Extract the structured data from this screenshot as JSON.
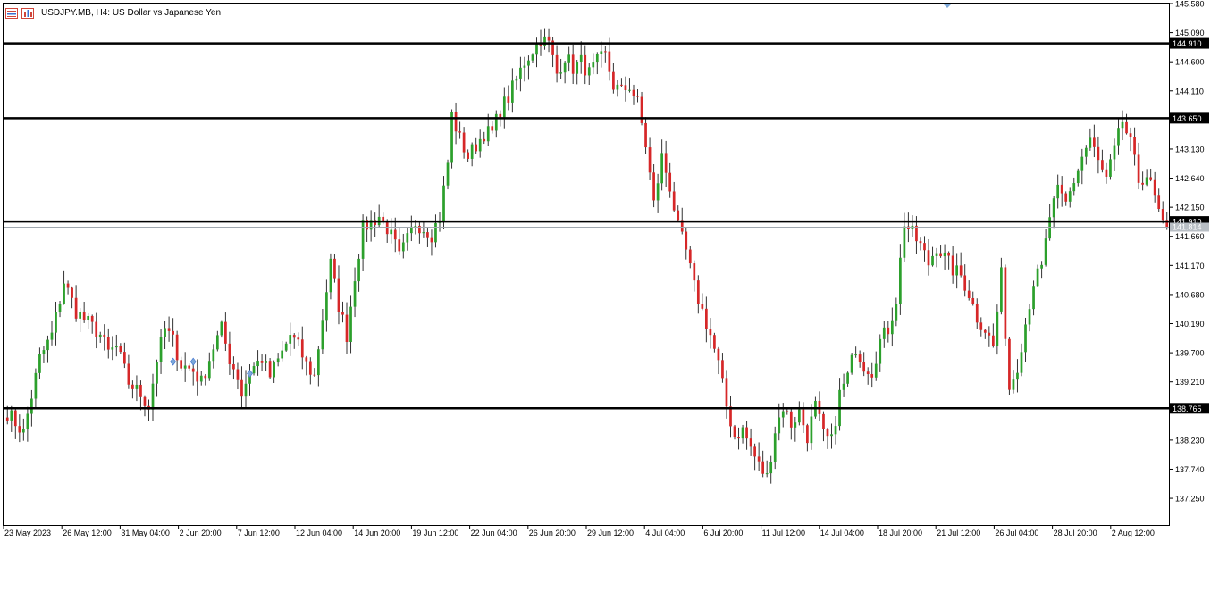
{
  "window": {
    "title": "USDJPY.MB, H4:  US Dollar vs Japanese Yen",
    "icons": [
      "chart-list-icon",
      "bar-chart-icon"
    ]
  },
  "colors": {
    "bull": "#2ca02c",
    "bear": "#d62728",
    "wick": "#333333",
    "level_line": "#000000",
    "price_line": "#a0a8b0",
    "axis": "#000000",
    "marker": "#7ba7d8"
  },
  "chart_data": {
    "type": "candlestick",
    "symbol": "USDJPY.MB",
    "timeframe": "H4",
    "ylim": [
      136.8,
      145.58
    ],
    "y_ticks": [
      "145.580",
      "145.090",
      "144.600",
      "144.110",
      "143.130",
      "142.640",
      "142.150",
      "141.660",
      "141.170",
      "140.680",
      "140.190",
      "139.700",
      "139.210",
      "138.230",
      "137.740",
      "137.250"
    ],
    "x_ticks": [
      "23 May 2023",
      "26 May 12:00",
      "31 May 04:00",
      "2 Jun 20:00",
      "7 Jun 12:00",
      "12 Jun 04:00",
      "14 Jun 20:00",
      "19 Jun 12:00",
      "22 Jun 04:00",
      "26 Jun 20:00",
      "29 Jun 12:00",
      "4 Jul 04:00",
      "6 Jul 20:00",
      "11 Jul 12:00",
      "14 Jul 04:00",
      "18 Jul 20:00",
      "21 Jul 12:00",
      "26 Jul 04:00",
      "28 Jul 20:00",
      "2 Aug 12:00"
    ],
    "levels": [
      {
        "label": "144.910",
        "value": 144.91
      },
      {
        "label": "143.650",
        "value": 143.65
      },
      {
        "label": "141.910",
        "value": 141.91
      },
      {
        "label": "138.765",
        "value": 138.765
      }
    ],
    "current_price": {
      "label": "141.814",
      "value": 141.814
    },
    "path": [
      [
        0,
        138.7
      ],
      [
        4,
        138.35
      ],
      [
        8,
        139.6
      ],
      [
        11,
        140.0
      ],
      [
        14,
        140.9
      ],
      [
        17,
        140.4
      ],
      [
        20,
        140.2
      ],
      [
        23,
        140.0
      ],
      [
        25,
        139.7
      ],
      [
        27,
        139.8
      ],
      [
        30,
        139.2
      ],
      [
        33,
        139.0
      ],
      [
        35,
        138.8
      ],
      [
        37,
        139.6
      ],
      [
        39,
        140.1
      ],
      [
        41,
        139.9
      ],
      [
        43,
        139.5
      ],
      [
        46,
        139.4
      ],
      [
        48,
        139.2
      ],
      [
        51,
        139.8
      ],
      [
        53,
        140.1
      ],
      [
        55,
        139.6
      ],
      [
        57,
        139.3
      ],
      [
        58,
        139.0
      ],
      [
        60,
        139.4
      ],
      [
        63,
        139.6
      ],
      [
        65,
        139.3
      ],
      [
        68,
        139.7
      ],
      [
        70,
        140.0
      ],
      [
        72,
        139.8
      ],
      [
        74,
        139.5
      ],
      [
        76,
        139.3
      ],
      [
        78,
        140.3
      ],
      [
        80,
        141.2
      ],
      [
        82,
        140.5
      ],
      [
        84,
        140.0
      ],
      [
        86,
        141.0
      ],
      [
        88,
        141.8
      ],
      [
        90,
        141.9
      ],
      [
        92,
        142.0
      ],
      [
        94,
        141.8
      ],
      [
        96,
        141.5
      ],
      [
        97,
        141.3
      ],
      [
        99,
        141.6
      ],
      [
        101,
        141.9
      ],
      [
        103,
        141.8
      ],
      [
        105,
        141.7
      ],
      [
        107,
        142.0
      ],
      [
        109,
        142.9
      ],
      [
        110,
        143.7
      ],
      [
        112,
        143.3
      ],
      [
        114,
        143.0
      ],
      [
        116,
        143.2
      ],
      [
        118,
        143.4
      ],
      [
        120,
        143.4
      ],
      [
        122,
        143.8
      ],
      [
        124,
        144.0
      ],
      [
        126,
        144.3
      ],
      [
        128,
        144.6
      ],
      [
        130,
        144.8
      ],
      [
        132,
        145.0
      ],
      [
        134,
        144.9
      ],
      [
        136,
        144.4
      ],
      [
        138,
        144.7
      ],
      [
        140,
        144.5
      ],
      [
        142,
        144.6
      ],
      [
        144,
        144.4
      ],
      [
        146,
        144.6
      ],
      [
        148,
        144.7
      ],
      [
        150,
        144.2
      ],
      [
        152,
        144.1
      ],
      [
        154,
        144.2
      ],
      [
        156,
        143.9
      ],
      [
        158,
        143.2
      ],
      [
        160,
        142.2
      ],
      [
        162,
        143.0
      ],
      [
        164,
        142.5
      ],
      [
        166,
        141.8
      ],
      [
        168,
        141.4
      ],
      [
        170,
        140.8
      ],
      [
        172,
        140.4
      ],
      [
        174,
        140.0
      ],
      [
        176,
        139.5
      ],
      [
        178,
        138.8
      ],
      [
        180,
        138.3
      ],
      [
        182,
        138.4
      ],
      [
        184,
        138.1
      ],
      [
        186,
        137.8
      ],
      [
        188,
        137.6
      ],
      [
        190,
        138.4
      ],
      [
        192,
        138.8
      ],
      [
        194,
        138.5
      ],
      [
        196,
        138.7
      ],
      [
        198,
        138.3
      ],
      [
        200,
        138.8
      ],
      [
        202,
        138.3
      ],
      [
        204,
        138.2
      ],
      [
        206,
        139.0
      ],
      [
        208,
        139.3
      ],
      [
        210,
        139.8
      ],
      [
        212,
        139.5
      ],
      [
        214,
        139.4
      ],
      [
        216,
        139.9
      ],
      [
        218,
        140.1
      ],
      [
        220,
        140.6
      ],
      [
        222,
        141.9
      ],
      [
        224,
        141.7
      ],
      [
        226,
        141.5
      ],
      [
        228,
        141.2
      ],
      [
        230,
        141.5
      ],
      [
        232,
        141.3
      ],
      [
        234,
        141.1
      ],
      [
        236,
        141.0
      ],
      [
        238,
        140.7
      ],
      [
        240,
        140.3
      ],
      [
        242,
        140.1
      ],
      [
        244,
        139.8
      ],
      [
        246,
        141.0
      ],
      [
        248,
        139.1
      ],
      [
        250,
        139.5
      ],
      [
        252,
        140.2
      ],
      [
        254,
        140.9
      ],
      [
        256,
        141.1
      ],
      [
        258,
        142.0
      ],
      [
        260,
        142.4
      ],
      [
        262,
        142.2
      ],
      [
        264,
        142.6
      ],
      [
        266,
        143.0
      ],
      [
        268,
        143.3
      ],
      [
        270,
        142.9
      ],
      [
        272,
        142.6
      ],
      [
        274,
        143.1
      ],
      [
        276,
        143.6
      ],
      [
        278,
        143.2
      ],
      [
        280,
        142.6
      ],
      [
        282,
        142.7
      ],
      [
        284,
        142.3
      ],
      [
        286,
        141.81
      ]
    ],
    "markers": [
      {
        "i": 41,
        "value": 139.55
      },
      {
        "i": 46,
        "value": 139.55
      },
      {
        "i": 60,
        "value": 139.35
      }
    ]
  }
}
